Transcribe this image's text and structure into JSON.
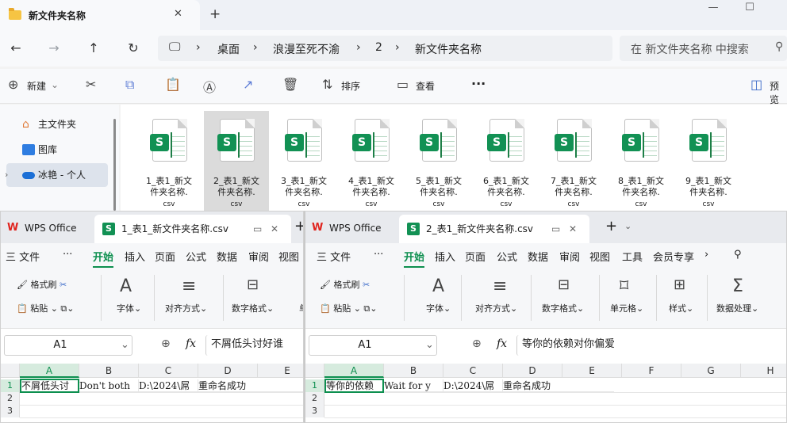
{
  "explorer": {
    "tab_title": "新文件夹名称",
    "tab_close": "✕",
    "new_tab": "+",
    "win_min": "—",
    "win_max": "☐",
    "breadcrumb": [
      "桌面",
      "浪漫至死不渝",
      "2",
      "新文件夹名称"
    ],
    "search_placeholder": "在 新文件夹名称 中搜索",
    "cmd_new": "新建",
    "cmd_sort": "排序",
    "cmd_view": "查看",
    "cmd_more": "···",
    "cmd_preview": "预览",
    "sidebar": [
      {
        "label": "主文件夹"
      },
      {
        "label": "图库"
      },
      {
        "label": "冰艳 - 个人"
      }
    ],
    "files": [
      {
        "line1": "1_表1_新文",
        "line2": "件夹名称.",
        "ext": "csv"
      },
      {
        "line1": "2_表1_新文",
        "line2": "件夹名称.",
        "ext": "csv"
      },
      {
        "line1": "3_表1_新文",
        "line2": "件夹名称.",
        "ext": "csv"
      },
      {
        "line1": "4_表1_新文",
        "line2": "件夹名称.",
        "ext": "csv"
      },
      {
        "line1": "5_表1_新文",
        "line2": "件夹名称.",
        "ext": "csv"
      },
      {
        "line1": "6_表1_新文",
        "line2": "件夹名称.",
        "ext": "csv"
      },
      {
        "line1": "7_表1_新文",
        "line2": "件夹名称.",
        "ext": "csv"
      },
      {
        "line1": "8_表1_新文",
        "line2": "件夹名称.",
        "ext": "csv"
      },
      {
        "line1": "9_表1_新文",
        "line2": "件夹名称.",
        "ext": "csv"
      }
    ]
  },
  "wps1": {
    "home_tab": "WPS Office",
    "doc_tab": "1_表1_新文件夹名称.csv",
    "menu": [
      "三 文件",
      "···",
      "开始",
      "插入",
      "页面",
      "公式",
      "数据",
      "审阅",
      "视图"
    ],
    "ribbon": {
      "format_painter": "格式刷",
      "paste": "粘贴",
      "font": "字体",
      "align": "对齐方式",
      "numfmt": "数字格式",
      "cut_tail": "单"
    },
    "cell_ref": "A1",
    "fx": "fx",
    "formula": "不屑低头讨好谁",
    "columns": [
      "A",
      "B",
      "C",
      "D",
      "E"
    ],
    "rows": [
      "1",
      "2",
      "3"
    ],
    "row1": [
      "不屑低头讨",
      "Don't both",
      "D:\\2024\\屌",
      "重命名成功"
    ]
  },
  "wps2": {
    "home_tab": "WPS Office",
    "doc_tab": "2_表1_新文件夹名称.csv",
    "menu": [
      "三 文件",
      "···",
      "开始",
      "插入",
      "页面",
      "公式",
      "数据",
      "审阅",
      "视图",
      "工具",
      "会员专享"
    ],
    "ribbon": {
      "format_painter": "格式刷",
      "paste": "粘贴",
      "font": "字体",
      "align": "对齐方式",
      "numfmt": "数字格式",
      "cell": "单元格",
      "style": "样式",
      "data": "数据处理"
    },
    "cell_ref": "A1",
    "fx": "fx",
    "formula": "等你的依赖对你偏爱",
    "columns": [
      "A",
      "B",
      "C",
      "D",
      "E",
      "F",
      "G",
      "H"
    ],
    "rows": [
      "1",
      "2",
      "3"
    ],
    "row1": [
      "等你的依赖",
      "Wait for y",
      "D:\\2024\\屌",
      "重命名成功"
    ]
  },
  "colors": {
    "wps_green": "#0d8f4f",
    "wps_red": "#e0251f",
    "csv_green": "#129154"
  }
}
